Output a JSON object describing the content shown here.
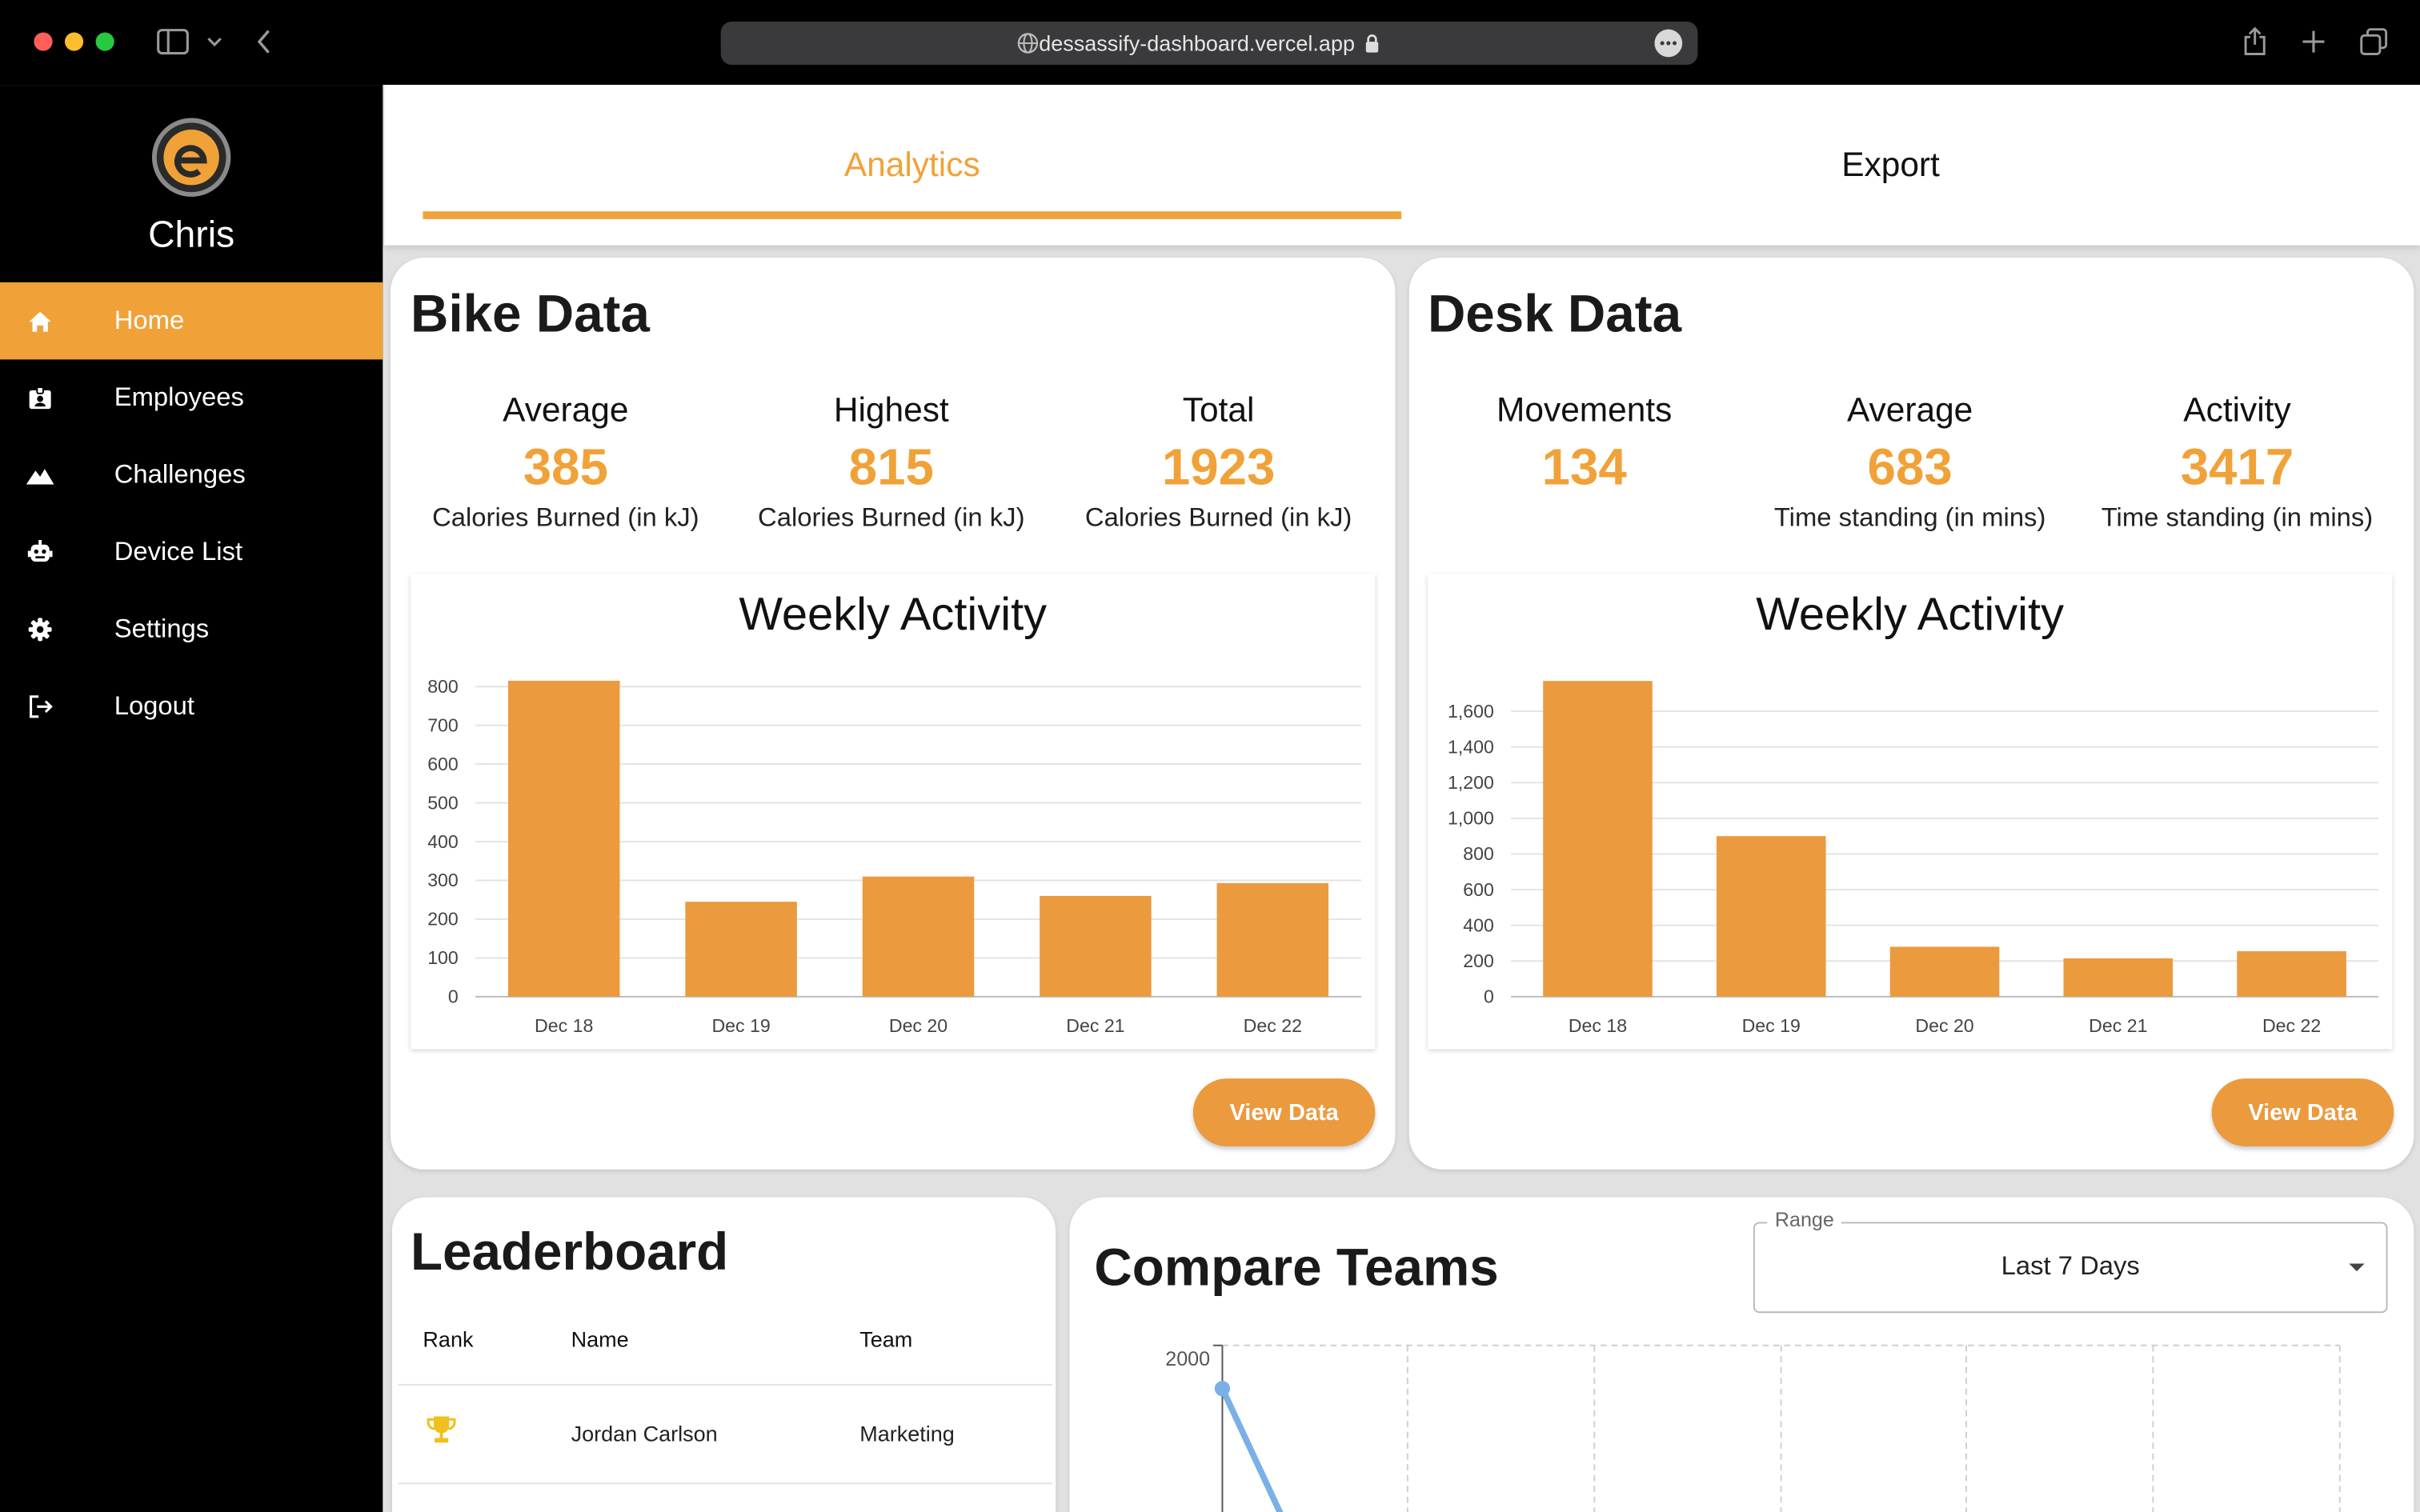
{
  "browser": {
    "url": "dessassify-dashboard.vercel.app"
  },
  "sidebar": {
    "user_name": "Chris",
    "items": [
      {
        "label": "Home",
        "icon": "home-icon",
        "active": true
      },
      {
        "label": "Employees",
        "icon": "badge-icon",
        "active": false
      },
      {
        "label": "Challenges",
        "icon": "mountain-icon",
        "active": false
      },
      {
        "label": "Device List",
        "icon": "robot-icon",
        "active": false
      },
      {
        "label": "Settings",
        "icon": "gear-icon",
        "active": false
      },
      {
        "label": "Logout",
        "icon": "logout-icon",
        "active": false
      }
    ]
  },
  "tabs": {
    "analytics": "Analytics",
    "export": "Export"
  },
  "bike": {
    "title": "Bike Data",
    "stats": [
      {
        "label": "Average",
        "value": "385",
        "unit": "Calories Burned (in kJ)"
      },
      {
        "label": "Highest",
        "value": "815",
        "unit": "Calories Burned (in kJ)"
      },
      {
        "label": "Total",
        "value": "1923",
        "unit": "Calories Burned (in kJ)"
      }
    ],
    "button": "View Data"
  },
  "desk": {
    "title": "Desk Data",
    "stats": [
      {
        "label": "Movements",
        "value": "134",
        "unit": ""
      },
      {
        "label": "Average",
        "value": "683",
        "unit": "Time standing (in mins)"
      },
      {
        "label": "Activity",
        "value": "3417",
        "unit": "Time standing (in mins)"
      }
    ],
    "button": "View Data"
  },
  "leaderboard": {
    "title": "Leaderboard",
    "columns": [
      "Rank",
      "Name",
      "Team"
    ],
    "rows": [
      {
        "rank_icon": "trophy-icon",
        "name": "Jordan Carlson",
        "team": "Marketing"
      }
    ]
  },
  "compare": {
    "title": "Compare Teams",
    "range_label": "Range",
    "range_value": "Last 7 Days"
  },
  "colors": {
    "accent": "#f0a238",
    "bar": "#eb9a3e",
    "line": "#7ab0e6",
    "trophy": "#f2c01e"
  },
  "chart_data": [
    {
      "type": "bar",
      "title": "Weekly Activity",
      "categories": [
        "Dec 18",
        "Dec 19",
        "Dec 20",
        "Dec 21",
        "Dec 22"
      ],
      "values": [
        815,
        245,
        310,
        260,
        293
      ],
      "yticks": [
        0,
        100,
        200,
        300,
        400,
        500,
        600,
        700,
        800
      ],
      "ytick_labels": [
        "0",
        "100",
        "200",
        "300",
        "400",
        "500",
        "600",
        "700",
        "800"
      ],
      "ylim": [
        0,
        800
      ],
      "grid": true
    },
    {
      "type": "bar",
      "title": "Weekly Activity",
      "categories": [
        "Dec 18",
        "Dec 19",
        "Dec 20",
        "Dec 21",
        "Dec 22"
      ],
      "values": [
        1770,
        900,
        280,
        215,
        255
      ],
      "yticks": [
        0,
        200,
        400,
        600,
        800,
        1000,
        1200,
        1400,
        1600
      ],
      "ytick_labels": [
        "0",
        "200",
        "400",
        "600",
        "800",
        "1,000",
        "1,200",
        "1,400",
        "1,600"
      ],
      "ylim": [
        0,
        1600
      ],
      "grid": true
    },
    {
      "type": "line",
      "title": "",
      "ytick_labels": [
        "2000"
      ],
      "series": [
        {
          "values": [
            2000
          ]
        }
      ],
      "grid": true
    }
  ]
}
